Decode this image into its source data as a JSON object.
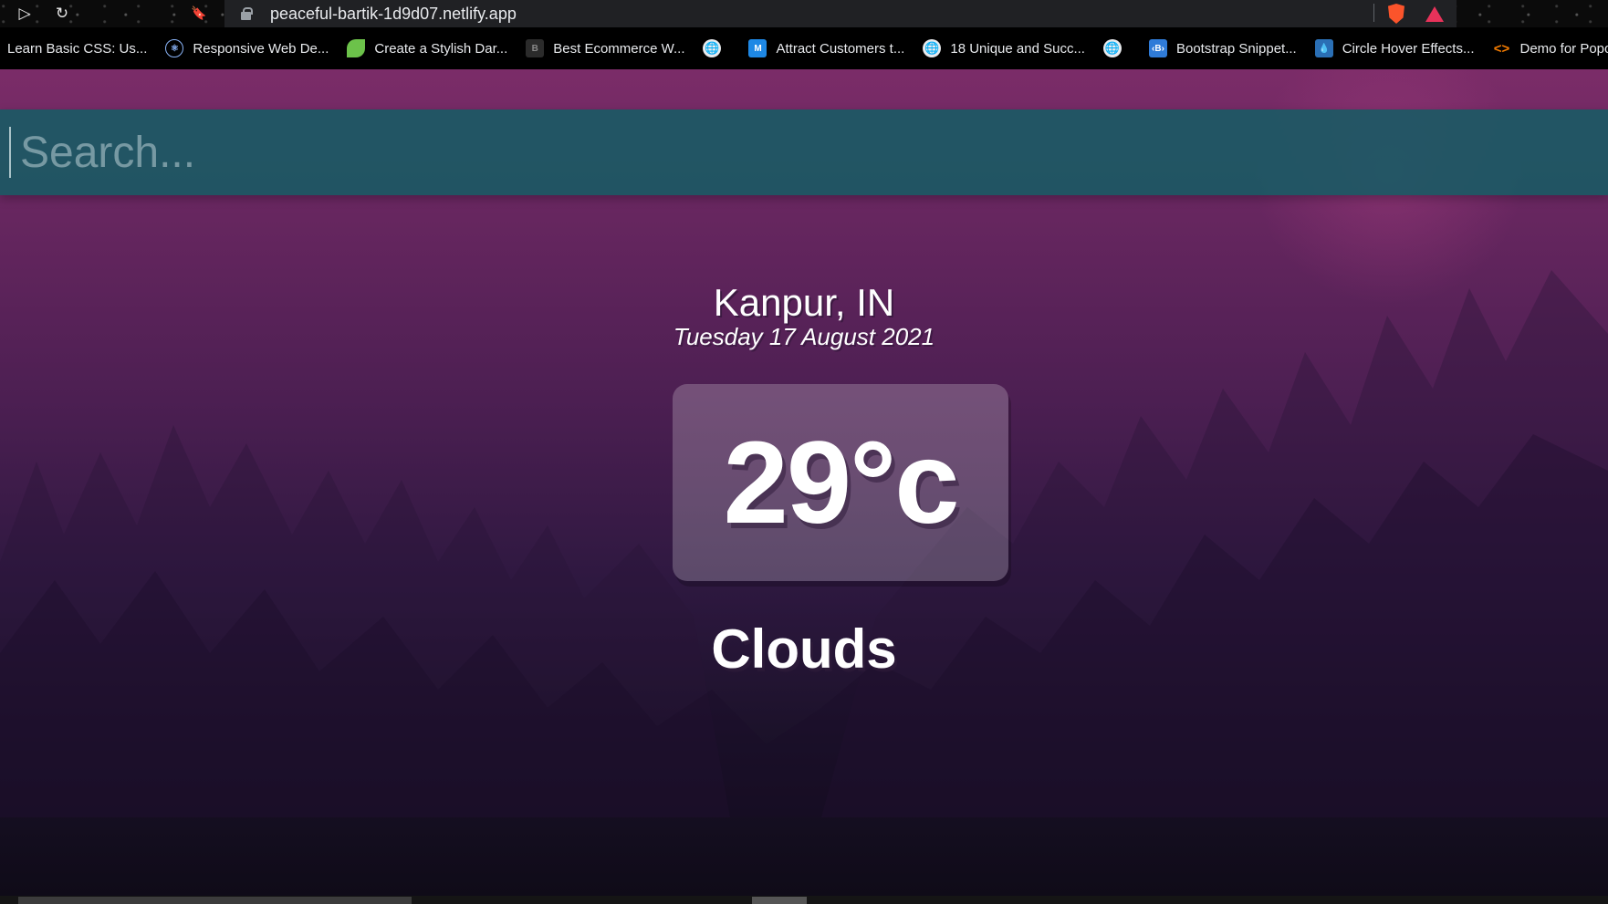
{
  "browser": {
    "url": "peaceful-bartik-1d9d07.netlify.app",
    "nav_icons": {
      "play": "▷",
      "reload": "↻",
      "bookmark": "🔖"
    }
  },
  "bookmarks": [
    {
      "label": "Learn Basic CSS: Us...",
      "icon": "none",
      "glyph": ""
    },
    {
      "label": "Responsive Web De...",
      "icon": "react",
      "glyph": "⚛"
    },
    {
      "label": "Create a Stylish Dar...",
      "icon": "leaf",
      "glyph": ""
    },
    {
      "label": "Best Ecommerce W...",
      "icon": "dark",
      "glyph": "B"
    },
    {
      "label": "",
      "icon": "globe",
      "glyph": "🌐"
    },
    {
      "label": "Attract Customers t...",
      "icon": "m",
      "glyph": "M"
    },
    {
      "label": "18 Unique and Succ...",
      "icon": "globe",
      "glyph": "🌐"
    },
    {
      "label": "",
      "icon": "globe",
      "glyph": "🌐"
    },
    {
      "label": "Bootstrap Snippet...",
      "icon": "b",
      "glyph": "‹B›"
    },
    {
      "label": "Circle Hover Effects...",
      "icon": "drop",
      "glyph": "💧"
    },
    {
      "label": "Demo for Popout D...",
      "icon": "code",
      "glyph": "<>"
    }
  ],
  "search": {
    "placeholder": "Search...",
    "value": ""
  },
  "weather": {
    "location": "Kanpur, IN",
    "date": "Tuesday 17 August 2021",
    "temperature": "29°c",
    "condition": "Clouds"
  },
  "colors": {
    "search_bg": "#1e5f69",
    "sky_top": "#7b2c68",
    "sky_bottom": "#0f0b18"
  }
}
